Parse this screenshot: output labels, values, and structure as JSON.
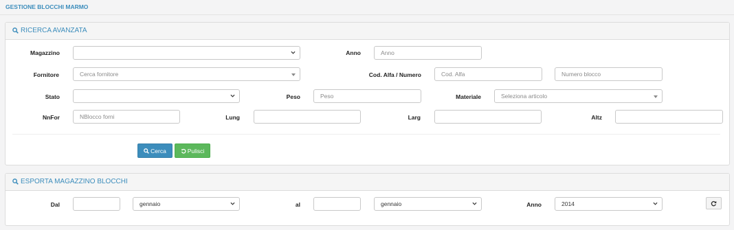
{
  "page": {
    "title": "GESTIONE BLOCCHI MARMO"
  },
  "search": {
    "title": "RICERCA AVANZATA",
    "magazzino_label": "Magazzino",
    "magazzino_value": "",
    "anno_label": "Anno",
    "anno_placeholder": "Anno",
    "fornitore_label": "Fornitore",
    "fornitore_placeholder": "Cerca fornitore",
    "cod_label": "Cod. Alfa / Numero",
    "cod_alfa_placeholder": "Cod. Alfa",
    "numero_placeholder": "Numero blocco",
    "stato_label": "Stato",
    "stato_value": "",
    "peso_label": "Peso",
    "peso_placeholder": "Peso",
    "materiale_label": "Materiale",
    "materiale_placeholder": "Seleziona articolo",
    "nnfor_label": "NnFor",
    "nnfor_placeholder": "NBlocco forni",
    "lung_label": "Lung",
    "larg_label": "Larg",
    "altz_label": "Altz",
    "search_button": "Cerca",
    "clear_button": "Pulisci"
  },
  "export": {
    "title": "ESPORTA MAGAZZINO BLOCCHI",
    "dal_label": "Dal",
    "dal_day": "",
    "dal_month": "gennaio",
    "al_label": "al",
    "al_day": "",
    "al_month": "gennaio",
    "anno_label": "Anno",
    "anno_value": "2014"
  },
  "icons": {
    "search": "search-icon",
    "refresh": "refresh-icon",
    "undo": "undo-icon",
    "chevron": "chevron-down-icon"
  },
  "colors": {
    "accent": "#3c8dbc",
    "success": "#5cb85c",
    "panel_bg": "#ffffff",
    "page_bg": "#f4f4f5"
  }
}
